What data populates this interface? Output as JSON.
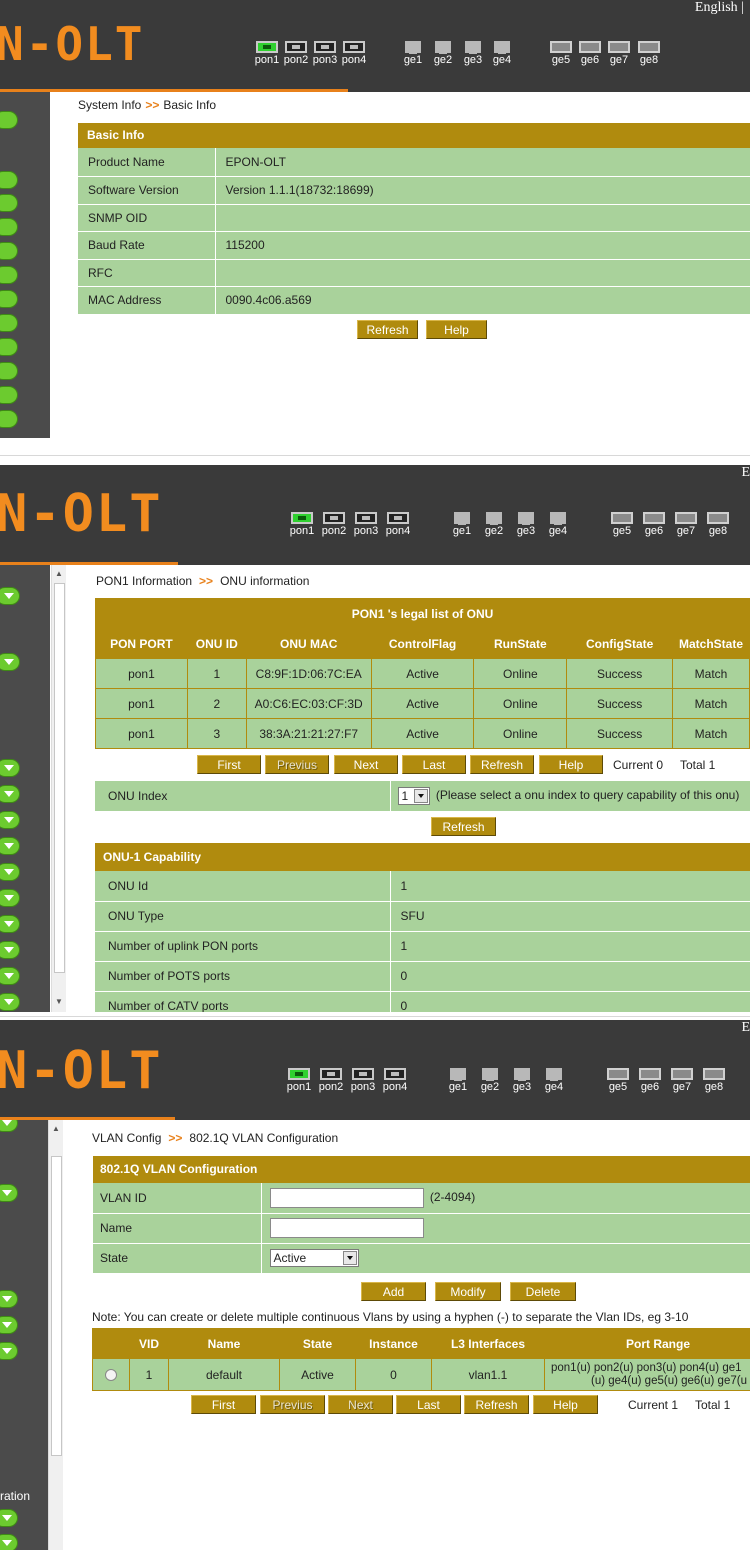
{
  "header": {
    "logo": "N-OLT",
    "language": "English |",
    "pon_ports": [
      "pon1",
      "pon2",
      "pon3",
      "pon4"
    ],
    "ge_ports_a": [
      "ge1",
      "ge2",
      "ge3",
      "ge4"
    ],
    "ge_ports_b": [
      "ge5",
      "ge6",
      "ge7",
      "ge8"
    ],
    "active_port": "pon1"
  },
  "colors": {
    "header": "#3a3a3a",
    "logo": "#f28c1f",
    "gold": "#b08b0e",
    "cell_green": "#a9d29b",
    "sidebar": "#4b4b4b",
    "menu_dot": "#6ccb2f",
    "port_active": "#2fd02f"
  },
  "screen1": {
    "breadcrumb": {
      "parent": "System Info",
      "sep": ">>",
      "current": "Basic Info"
    },
    "panel_title": "Basic Info",
    "rows": [
      {
        "label": "Product Name",
        "value": "EPON-OLT"
      },
      {
        "label": "Software Version",
        "value": "Version 1.1.1(18732:18699)"
      },
      {
        "label": "SNMP OID",
        "value": ""
      },
      {
        "label": "Baud Rate",
        "value": "115200"
      },
      {
        "label": "RFC",
        "value": ""
      },
      {
        "label": "MAC Address",
        "value": "0090.4c06.a569"
      }
    ],
    "buttons": {
      "refresh": "Refresh",
      "help": "Help"
    }
  },
  "screen2": {
    "breadcrumb": {
      "parent": "PON1 Information",
      "sep": ">>",
      "current": "ONU information"
    },
    "table_title": "PON1 's legal list of ONU",
    "columns": [
      "PON PORT",
      "ONU ID",
      "ONU MAC",
      "ControlFlag",
      "RunState",
      "ConfigState",
      "MatchState"
    ],
    "rows": [
      [
        "pon1",
        "1",
        "C8:9F:1D:06:7C:EA",
        "Active",
        "Online",
        "Success",
        "Match"
      ],
      [
        "pon1",
        "2",
        "A0:C6:EC:03:CF:3D",
        "Active",
        "Online",
        "Success",
        "Match"
      ],
      [
        "pon1",
        "3",
        "38:3A:21:21:27:F7",
        "Active",
        "Online",
        "Success",
        "Match"
      ]
    ],
    "pager": {
      "first": "First",
      "previous": "Previus",
      "next": "Next",
      "last": "Last",
      "refresh": "Refresh",
      "help": "Help",
      "current": "Current  0",
      "total": "Total  1"
    },
    "onu_index": {
      "label": "ONU  Index",
      "selected": "1",
      "hint": "(Please select a onu index to query capability of this onu)",
      "refresh": "Refresh"
    },
    "capability_title": "ONU-1 Capability",
    "capability_rows": [
      {
        "label": "ONU Id",
        "value": "1"
      },
      {
        "label": "ONU Type",
        "value": "SFU"
      },
      {
        "label": "Number of uplink PON ports",
        "value": "1"
      },
      {
        "label": "Number of POTS ports",
        "value": "0"
      },
      {
        "label": "Number of CATV ports",
        "value": "0"
      }
    ]
  },
  "screen3": {
    "breadcrumb": {
      "parent": "VLAN Config",
      "sep": ">>",
      "current": "802.1Q VLAN Configuration"
    },
    "panel_title": "802.1Q VLAN Configuration",
    "form": {
      "vlan_id_label": "VLAN ID",
      "vlan_id_value": "",
      "vlan_id_range": "(2-4094)",
      "name_label": "Name",
      "name_value": "",
      "state_label": "State",
      "state_value": "Active"
    },
    "buttons": {
      "add": "Add",
      "modify": "Modify",
      "delete": "Delete"
    },
    "note": "Note: You can create or delete multiple continuous Vlans by using a hyphen (-) to separate the Vlan IDs, eg 3-10",
    "columns": [
      "",
      "VID",
      "Name",
      "State",
      "Instance",
      "L3 Interfaces",
      "Port Range"
    ],
    "rows": [
      {
        "vid": "1",
        "name": "default",
        "state": "Active",
        "instance": "0",
        "l3": "vlan1.1",
        "ports_line1": "pon1(u) pon2(u) pon3(u) pon4(u) ge1",
        "ports_line2": "(u) ge4(u) ge5(u) ge6(u) ge7(u"
      }
    ],
    "pager": {
      "first": "First",
      "previous": "Previus",
      "next": "Next",
      "last": "Last",
      "refresh": "Refresh",
      "help": "Help",
      "current": "Current  1",
      "total": "Total  1"
    },
    "sidebar_label": "ration"
  }
}
